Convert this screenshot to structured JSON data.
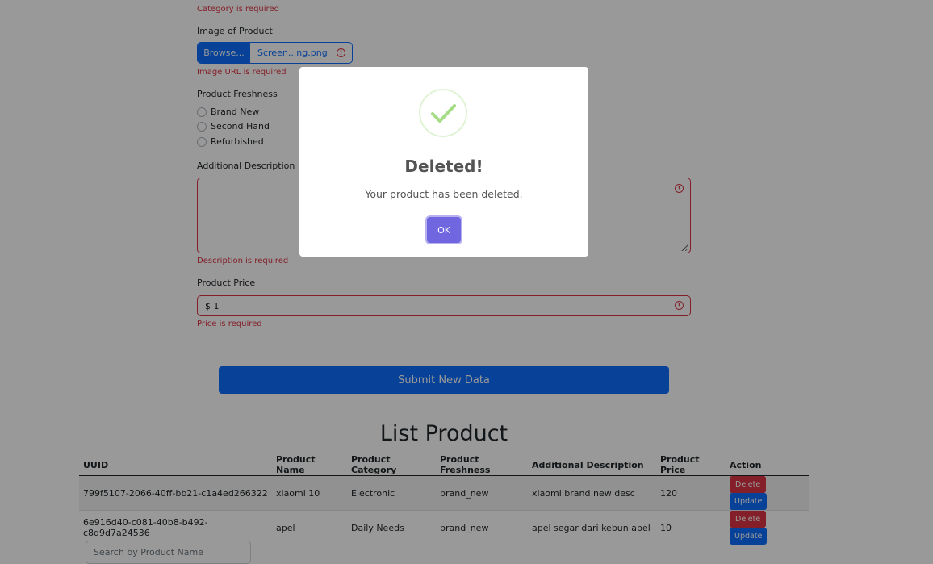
{
  "form": {
    "category_error": "Category is required",
    "image_label": "Image of Product",
    "browse_label": "Browse...",
    "file_name": "Screen...ng.png",
    "image_error": "Image URL is required",
    "freshness_label": "Product Freshness",
    "freshness_options": [
      "Brand New",
      "Second Hand",
      "Refurbished"
    ],
    "description_label": "Additional Description",
    "description_value": "",
    "description_error": "Description is required",
    "price_label": "Product Price",
    "price_value": "$ 1",
    "price_error": "Price is required",
    "submit_label": "Submit New Data",
    "warning_glyph": "!"
  },
  "list": {
    "title": "List Product",
    "columns": [
      "UUID",
      "Product Name",
      "Product Category",
      "Product Freshness",
      "Additional Description",
      "Product Price",
      "Action"
    ],
    "rows": [
      [
        "799f5107-2066-40ff-bb21-c1a4ed266322",
        "xiaomi 10",
        "Electronic",
        "brand_new",
        "xiaomi brand new desc",
        "120"
      ],
      [
        "6e916d40-c081-40b8-b492-c8d9d7a24536",
        "apel",
        "Daily Needs",
        "brand_new",
        "apel segar dari kebun apel",
        "10"
      ]
    ],
    "delete_label": "Delete",
    "update_label": "Update",
    "search_placeholder": "Search by Product Name"
  },
  "modal": {
    "icon": "success-check-icon",
    "title": "Deleted!",
    "text": "Your product has been deleted.",
    "ok_label": "OK"
  },
  "colors": {
    "primary": "#0d6efd",
    "danger": "#dc3545",
    "modal_confirm": "#7066e0",
    "success": "#a5dc86"
  }
}
